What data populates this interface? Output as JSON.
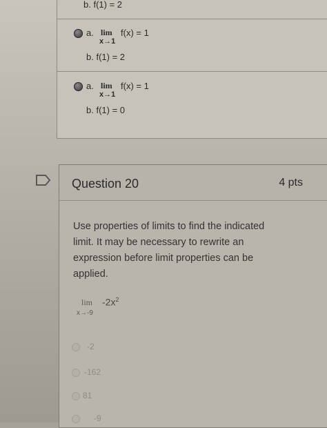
{
  "previous_question": {
    "cut_off_line": "b. f(1) = 2",
    "options": [
      {
        "letter": "a.",
        "lim_word": "lim",
        "lim_sub": "x→1",
        "expression": "f(x) = 1",
        "second_line": "b. f(1) = 2"
      },
      {
        "letter": "a.",
        "lim_word": "lim",
        "lim_sub": "x→1",
        "expression": "f(x) = 1",
        "second_line": "b. f(1) = 0"
      }
    ]
  },
  "question": {
    "title": "Question 20",
    "points": "4 pts",
    "prompt": "Use properties of limits to find the indicated limit. It may be necessary to rewrite an expression before limit properties can be applied.",
    "prompt_lines": [
      "Use properties of limits to find the indicated",
      "limit. It may be necessary to rewrite an",
      "expression before limit properties can be",
      "applied."
    ],
    "lim_word": "lim",
    "lim_sub": "x→-9",
    "expression": "-2x",
    "exponent": "2",
    "answers": [
      "-2",
      "-162",
      "81",
      "-9"
    ]
  },
  "colors": {
    "card_border": "#8d8a84",
    "radio_selected": "#4a4a4a"
  }
}
